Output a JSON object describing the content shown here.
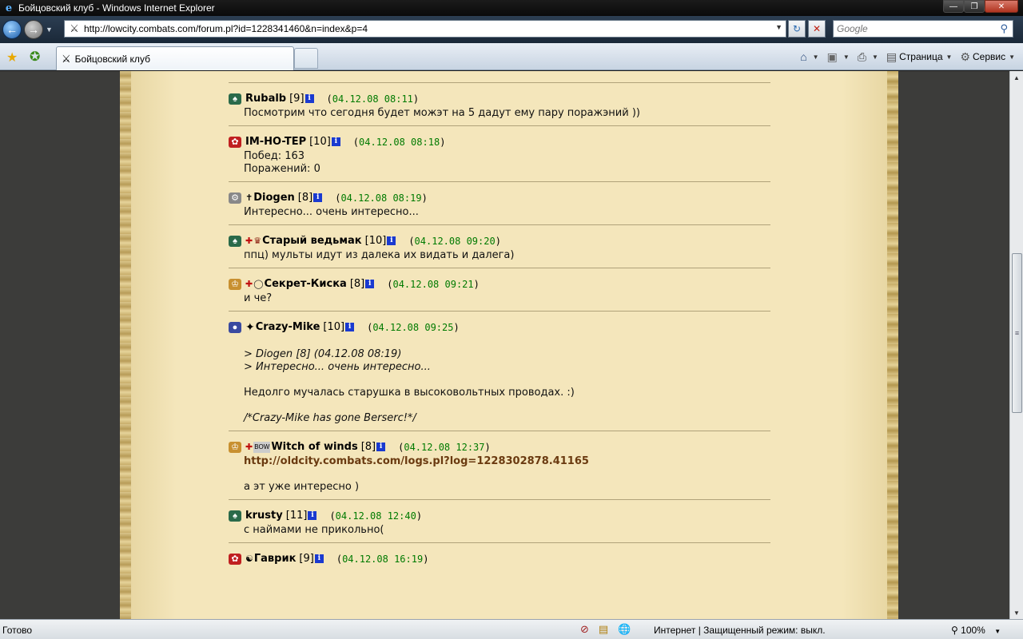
{
  "window": {
    "title": "Бойцовский клуб - Windows Internet Explorer"
  },
  "address": {
    "url": "http://lowcity.combats.com/forum.pl?id=1228341460&n=index&p=4"
  },
  "search": {
    "placeholder": "Google"
  },
  "tab": {
    "label": "Бойцовский клуб"
  },
  "commands": {
    "page": "Страница",
    "tools": "Сервис"
  },
  "posts": [
    {
      "nick": "Rubalb",
      "level": "[9]",
      "date": "04.12.08 08:11",
      "lines": [
        "Посмотрим что сегодня будет можэт на 5 дадут ему пару поражэний ))"
      ]
    },
    {
      "nick": "IM-HO-TEP",
      "level": "[10]",
      "date": "04.12.08 08:18",
      "lines": [
        "Побед: 163",
        "Поражений: 0"
      ]
    },
    {
      "nick": "Diogen",
      "level": "[8]",
      "date": "04.12.08 08:19",
      "lines": [
        "Интересно... очень интересно..."
      ]
    },
    {
      "nick": "Старый ведьмак",
      "level": "[10]",
      "date": "04.12.08 09:20",
      "lines": [
        "ппц) мульты идут из далека их видать и далега)"
      ]
    },
    {
      "nick": "Секрет-Киска",
      "level": "[8]",
      "date": "04.12.08 09:21",
      "lines": [
        "и че?"
      ]
    },
    {
      "nick": "Crazy-Mike",
      "level": "[10]",
      "date": "04.12.08 09:25",
      "quote1": "> Diogen [8]   (04.12.08 08:19)",
      "quote2": "> Интересно... очень интересно...",
      "text": "Недолго мучалась старушка в высоковольтных проводах. :)",
      "signature": "/*Crazy-Mike has gone Berserc!*/"
    },
    {
      "nick": "Witch of winds",
      "level": "[8]",
      "date": "04.12.08 12:37",
      "link": "http://oldcity.combats.com/logs.pl?log=1228302878.41165",
      "text": "а эт уже интересно )"
    },
    {
      "nick": "krusty",
      "level": "[11]",
      "date": "04.12.08 12:40",
      "lines": [
        "с наймами не прикольно("
      ]
    },
    {
      "nick": "Гаврик",
      "level": "[9]",
      "date": "04.12.08 16:19",
      "lines": []
    }
  ],
  "status": {
    "ready": "Готово",
    "zone": "Интернет | Защищенный режим: выкл.",
    "zoom": "100%"
  },
  "colors": {
    "parchment": "#f4e6bb",
    "date_green": "#007a00",
    "link_brown": "#6a3a10",
    "info_blue": "#1a3ad0"
  }
}
